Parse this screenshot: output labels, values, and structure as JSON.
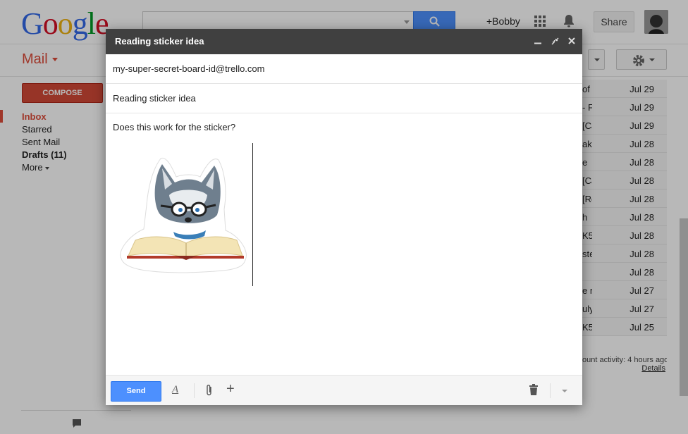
{
  "header": {
    "logo_letters": [
      "G",
      "o",
      "o",
      "g",
      "l",
      "e"
    ],
    "logo_colors": [
      "#3369e8",
      "#d50f25",
      "#eeb211",
      "#3369e8",
      "#009925",
      "#d50f25"
    ],
    "user_name": "+Bobby",
    "share_label": "Share"
  },
  "mail_label": "Mail",
  "sidebar": {
    "compose_label": "COMPOSE",
    "items": [
      {
        "label": "Inbox"
      },
      {
        "label": "Starred"
      },
      {
        "label": "Sent Mail"
      },
      {
        "label": "Drafts (11)"
      },
      {
        "label": "More"
      }
    ]
  },
  "messages": [
    {
      "snippet": "of r",
      "date": "Jul 29"
    },
    {
      "snippet": "- F",
      "date": "Jul 29"
    },
    {
      "snippet": "[Ca",
      "date": "Jul 29"
    },
    {
      "snippet": "ak",
      "date": "Jul 28"
    },
    {
      "snippet": "e",
      "date": "Jul 28"
    },
    {
      "snippet": "[Ca",
      "date": "Jul 28"
    },
    {
      "snippet": "[Re",
      "date": "Jul 28"
    },
    {
      "snippet": "h",
      "date": "Jul 28"
    },
    {
      "snippet": "K5",
      "date": "Jul 28"
    },
    {
      "snippet": "ste",
      "date": "Jul 28"
    },
    {
      "snippet": "",
      "date": "Jul 28"
    },
    {
      "snippet": "e r",
      "date": "Jul 27"
    },
    {
      "snippet": "uly",
      "date": "Jul 27"
    },
    {
      "snippet": "K5",
      "date": "Jul 25"
    }
  ],
  "footer_info": {
    "activity": "ount activity: 4 hours ago",
    "details": "Details"
  },
  "compose": {
    "title": "Reading sticker idea",
    "to": "my-super-secret-board-id@trello.com",
    "subject": "Reading sticker idea",
    "body": "Does this work for the sticker?",
    "send_label": "Send",
    "controls": {
      "minimize": "minimize-icon",
      "popout": "popout-icon",
      "close": "close-icon"
    }
  }
}
